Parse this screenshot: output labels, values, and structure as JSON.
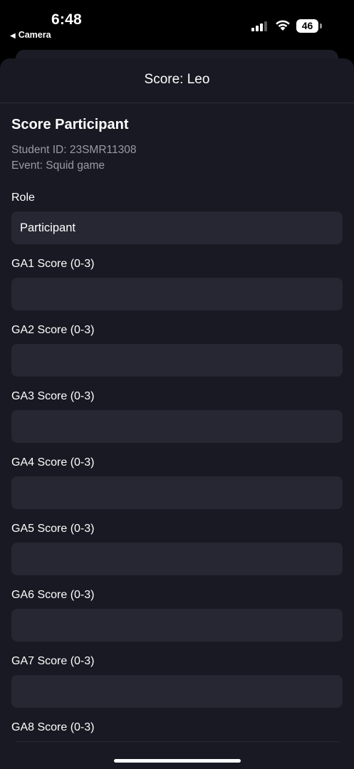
{
  "status_bar": {
    "time": "6:48",
    "back_app": "Camera",
    "battery": "46"
  },
  "sheet": {
    "title": "Score: Leo"
  },
  "form": {
    "section_title": "Score Participant",
    "student_id": "Student ID: 23SMR11308",
    "event": "Event: Squid game",
    "role_label": "Role",
    "role_value": "Participant",
    "fields": [
      {
        "label": "GA1 Score (0-3)",
        "value": ""
      },
      {
        "label": "GA2 Score (0-3)",
        "value": ""
      },
      {
        "label": "GA3 Score (0-3)",
        "value": ""
      },
      {
        "label": "GA4 Score (0-3)",
        "value": ""
      },
      {
        "label": "GA5 Score (0-3)",
        "value": ""
      },
      {
        "label": "GA6 Score (0-3)",
        "value": ""
      },
      {
        "label": "GA7 Score (0-3)",
        "value": ""
      },
      {
        "label": "GA8 Score (0-3)",
        "value": ""
      }
    ]
  },
  "colors": {
    "background": "#000000",
    "sheet": "#181922",
    "field": "#262732",
    "muted_text": "#9a9ba5"
  },
  "icons": [
    "back-triangle-icon",
    "signal-icon",
    "wifi-icon",
    "battery-icon"
  ]
}
